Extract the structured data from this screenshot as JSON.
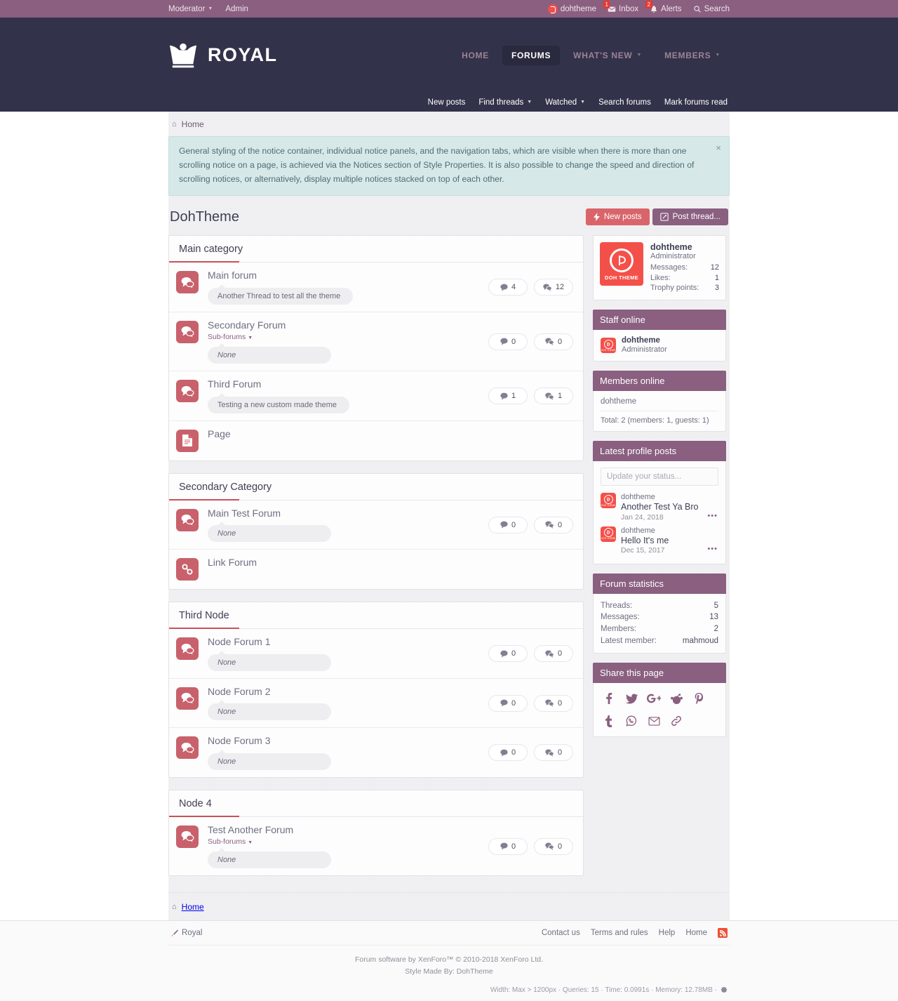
{
  "topbar": {
    "left": [
      {
        "label": "Moderator",
        "icon": "chevron-down-icon",
        "has_caret": true
      },
      {
        "label": "Admin",
        "has_caret": false
      }
    ],
    "right": [
      {
        "label": "dohtheme",
        "icon": "user-avatar-icon",
        "badge": ""
      },
      {
        "label": "Inbox",
        "icon": "envelope-icon",
        "badge": "1"
      },
      {
        "label": "Alerts",
        "icon": "bell-icon",
        "badge": "2"
      },
      {
        "label": "Search",
        "icon": "search-icon",
        "badge": ""
      }
    ]
  },
  "header": {
    "logo_text": "ROYAL",
    "logo_icon": "crown-icon",
    "nav": [
      {
        "label": "HOME",
        "active": false,
        "caret": false
      },
      {
        "label": "FORUMS",
        "active": true,
        "caret": false
      },
      {
        "label": "WHAT'S NEW",
        "active": false,
        "caret": true
      },
      {
        "label": "MEMBERS",
        "active": false,
        "caret": true
      }
    ]
  },
  "subnav": [
    {
      "label": "New posts",
      "caret": false
    },
    {
      "label": "Find threads",
      "caret": true
    },
    {
      "label": "Watched",
      "caret": true
    },
    {
      "label": "Search forums",
      "caret": false
    },
    {
      "label": "Mark forums read",
      "caret": false
    }
  ],
  "breadcrumb": {
    "home_label": "Home",
    "icon": "home-icon"
  },
  "notice": {
    "text": "General styling of the notice container, individual notice panels, and the navigation tabs, which are visible when there is more than one scrolling notice on a page, is achieved via the Notices section of Style Properties. It is also possible to change the speed and direction of scrolling notices, or alternatively, display multiple notices stacked on top of each other.",
    "close_label": "×"
  },
  "page": {
    "title": "DohTheme",
    "actions": [
      {
        "label": "New posts",
        "icon": "bolt-icon",
        "style": "red"
      },
      {
        "label": "Post thread...",
        "icon": "pencil-square-icon",
        "style": "purple"
      }
    ]
  },
  "categories": [
    {
      "title": "Main category",
      "nodes": [
        {
          "title": "Main forum",
          "icon": "forum-bubble-icon",
          "subforums": null,
          "lastpost": "Another Thread to test all the theme",
          "lastpost_italic": false,
          "threads": "4",
          "messages": "12",
          "show_stats": true,
          "show_lastpost": true
        },
        {
          "title": "Secondary Forum",
          "icon": "forum-bubble-icon",
          "subforums": "Sub-forums",
          "lastpost": "None",
          "lastpost_italic": true,
          "threads": "0",
          "messages": "0",
          "show_stats": true,
          "show_lastpost": true
        },
        {
          "title": "Third Forum",
          "icon": "forum-bubble-icon",
          "subforums": null,
          "lastpost": "Testing a new custom made theme",
          "lastpost_italic": false,
          "threads": "1",
          "messages": "1",
          "show_stats": true,
          "show_lastpost": true
        },
        {
          "title": "Page",
          "icon": "page-document-icon",
          "subforums": null,
          "lastpost": null,
          "lastpost_italic": false,
          "threads": null,
          "messages": null,
          "show_stats": false,
          "show_lastpost": false
        }
      ]
    },
    {
      "title": "Secondary Category",
      "nodes": [
        {
          "title": "Main Test Forum",
          "icon": "forum-bubble-icon",
          "subforums": null,
          "lastpost": "None",
          "lastpost_italic": true,
          "threads": "0",
          "messages": "0",
          "show_stats": true,
          "show_lastpost": true
        },
        {
          "title": "Link Forum",
          "icon": "link-chain-icon",
          "subforums": null,
          "lastpost": null,
          "lastpost_italic": false,
          "threads": null,
          "messages": null,
          "show_stats": false,
          "show_lastpost": false
        }
      ]
    },
    {
      "title": "Third Node",
      "nodes": [
        {
          "title": "Node Forum 1",
          "icon": "forum-bubble-icon",
          "subforums": null,
          "lastpost": "None",
          "lastpost_italic": true,
          "threads": "0",
          "messages": "0",
          "show_stats": true,
          "show_lastpost": true
        },
        {
          "title": "Node Forum 2",
          "icon": "forum-bubble-icon",
          "subforums": null,
          "lastpost": "None",
          "lastpost_italic": true,
          "threads": "0",
          "messages": "0",
          "show_stats": true,
          "show_lastpost": true
        },
        {
          "title": "Node Forum 3",
          "icon": "forum-bubble-icon",
          "subforums": null,
          "lastpost": "None",
          "lastpost_italic": true,
          "threads": "0",
          "messages": "0",
          "show_stats": true,
          "show_lastpost": true
        }
      ]
    },
    {
      "title": "Node 4",
      "nodes": [
        {
          "title": "Test Another Forum",
          "icon": "forum-bubble-icon",
          "subforums": "Sub-forums",
          "lastpost": "None",
          "lastpost_italic": true,
          "threads": "0",
          "messages": "0",
          "show_stats": true,
          "show_lastpost": true
        }
      ]
    }
  ],
  "sidebar": {
    "visitor": {
      "avatar_label": "DOH THEME",
      "name": "dohtheme",
      "role": "Administrator",
      "stats": [
        {
          "label": "Messages:",
          "value": "12"
        },
        {
          "label": "Likes:",
          "value": "1"
        },
        {
          "label": "Trophy points:",
          "value": "3"
        }
      ]
    },
    "staff_online": {
      "title": "Staff online",
      "members": [
        {
          "name": "dohtheme",
          "role": "Administrator"
        }
      ]
    },
    "members_online": {
      "title": "Members online",
      "names": "dohtheme",
      "total": "Total: 2 (members: 1, guests: 1)"
    },
    "profile_posts": {
      "title": "Latest profile posts",
      "status_placeholder": "Update your status...",
      "items": [
        {
          "user": "dohtheme",
          "text": "Another Test Ya Bro",
          "date": "Jan 24, 2018",
          "more": "•••"
        },
        {
          "user": "dohtheme",
          "text": "Hello It's me",
          "date": "Dec 15, 2017",
          "more": "•••"
        }
      ]
    },
    "forum_statistics": {
      "title": "Forum statistics",
      "rows": [
        {
          "label": "Threads:",
          "value": "5"
        },
        {
          "label": "Messages:",
          "value": "13"
        },
        {
          "label": "Members:",
          "value": "2"
        },
        {
          "label": "Latest member:",
          "value": "mahmoud"
        }
      ]
    },
    "share": {
      "title": "Share this page",
      "icons": [
        {
          "name": "facebook-icon",
          "glyph": "f"
        },
        {
          "name": "twitter-icon",
          "glyph": "t"
        },
        {
          "name": "google-plus-icon",
          "glyph": "G+"
        },
        {
          "name": "reddit-icon",
          "glyph": "r"
        },
        {
          "name": "pinterest-icon",
          "glyph": "P"
        },
        {
          "name": "tumblr-icon",
          "glyph": "t"
        },
        {
          "name": "whatsapp-icon",
          "glyph": "w"
        },
        {
          "name": "email-icon",
          "glyph": "e"
        },
        {
          "name": "link-icon",
          "glyph": "l"
        }
      ]
    }
  },
  "footer": {
    "style_label": "Royal",
    "style_icon": "paintbrush-icon",
    "links": [
      {
        "label": "Contact us"
      },
      {
        "label": "Terms and rules"
      },
      {
        "label": "Help"
      },
      {
        "label": "Home"
      }
    ],
    "rss_icon": "rss-icon",
    "copyright_line1": "Forum software by XenForo™ © 2010-2018 XenForo Ltd.",
    "copyright_line2": "Style Made By: DohTheme",
    "debug": "Width: Max > 1200px · Queries: 15 · Time: 0.0991s · Memory: 12.78MB ·",
    "debug_icon": "gear-icon"
  },
  "colors": {
    "topbar": "#8a5f80",
    "header": "#32334a",
    "accent_red": "#c8616b",
    "accent_coral": "#f4504a",
    "notice_bg": "#d6e9e8"
  }
}
